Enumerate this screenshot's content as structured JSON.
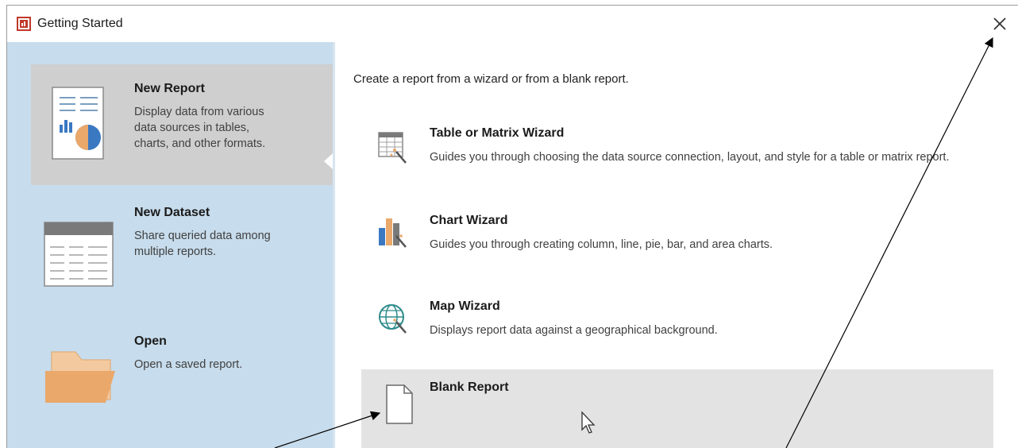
{
  "window": {
    "title": "Getting Started",
    "icon": "report-builder-app-icon",
    "close_icon": "close-icon"
  },
  "sidebar": {
    "items": [
      {
        "title": "New Report",
        "description": "Display data from various\ndata sources in tables,\ncharts, and other formats.",
        "icon": "new-report-icon",
        "selected": true
      },
      {
        "title": "New Dataset",
        "description": "Share queried data among\nmultiple reports.",
        "icon": "dataset-table-icon",
        "selected": false
      },
      {
        "title": "Open",
        "description": "Open a saved report.",
        "icon": "folder-icon",
        "selected": false
      }
    ]
  },
  "main": {
    "intro": "Create a report from a wizard or from a blank report.",
    "options": [
      {
        "title": "Table or Matrix Wizard",
        "description": "Guides you through choosing the data source connection, layout, and style for a table or matrix report.",
        "icon": "table-wizard-icon"
      },
      {
        "title": "Chart Wizard",
        "description": "Guides you through creating column, line, pie, bar, and area charts.",
        "icon": "chart-wizard-icon"
      },
      {
        "title": "Map Wizard",
        "description": "Displays report data against a geographical background.",
        "icon": "map-wizard-icon"
      },
      {
        "title": "Blank Report",
        "description": "",
        "icon": "blank-page-icon",
        "hovered": true
      }
    ]
  },
  "colors": {
    "sidebar_bg": "#c7dcec",
    "selected_bg": "#cfcfcf",
    "hover_bg": "#e3e3e3",
    "folder": "#eaa86a",
    "app_icon": "#c0392b"
  }
}
